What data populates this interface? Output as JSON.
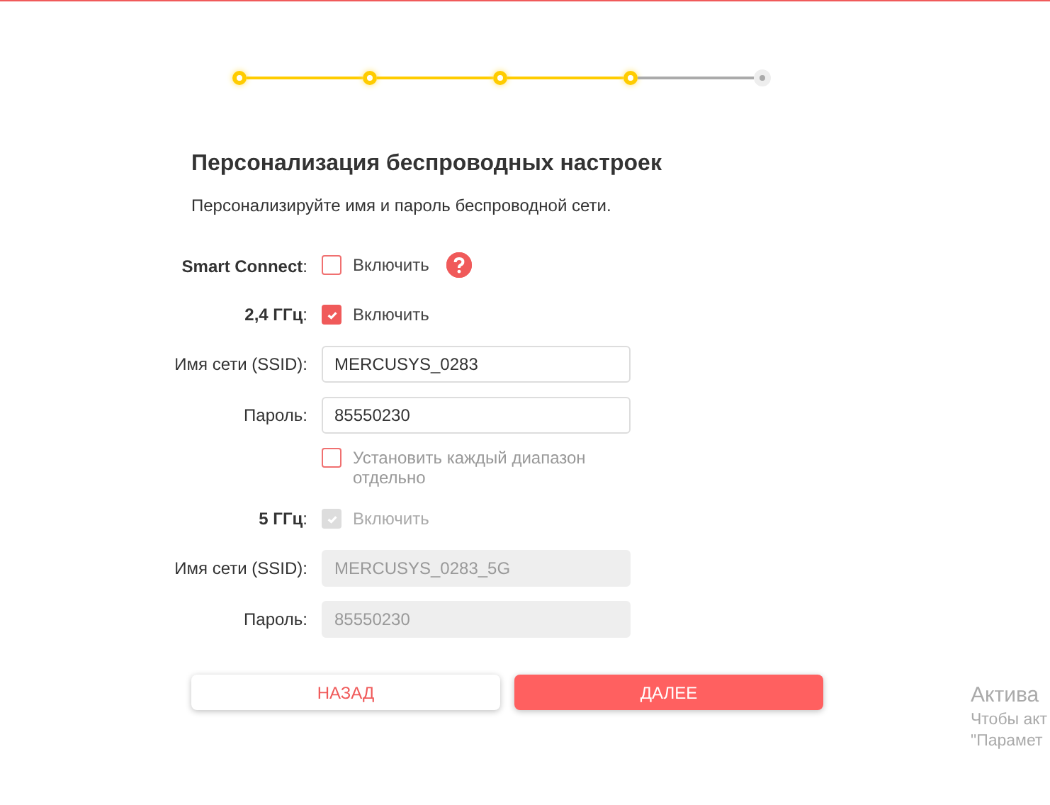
{
  "stepper": {
    "steps": [
      {
        "done": true
      },
      {
        "done": true
      },
      {
        "done": true
      },
      {
        "done": true
      },
      {
        "done": false
      }
    ]
  },
  "heading": {
    "title": "Персонализация беспроводных настроек",
    "subtitle": "Персонализируйте имя и пароль беспроводной сети."
  },
  "form": {
    "rows": [
      {
        "kind": "checkbox",
        "label": "**Smart Connect**:",
        "option": "Включить",
        "checked": false,
        "disabled": false,
        "help": true
      },
      {
        "kind": "checkbox",
        "label": "**2,4 ГГц**:",
        "option": "Включить",
        "checked": true,
        "disabled": false,
        "help": false
      },
      {
        "kind": "input",
        "label": "Имя сети (SSID):",
        "value": "MERCUSYS_0283",
        "disabled": false
      },
      {
        "kind": "input",
        "label": "Пароль:",
        "value": "85550230",
        "disabled": false
      },
      {
        "kind": "checkbox",
        "option": "Установить каждый диапазон отдельно",
        "checked": false,
        "disabled": false,
        "help": false
      },
      {
        "kind": "checkbox",
        "label": "**5 ГГц**:",
        "option": "Включить",
        "checked": true,
        "disabled": true,
        "help": false
      },
      {
        "kind": "input",
        "label": "Имя сети (SSID):",
        "value": "MERCUSYS_0283_5G",
        "disabled": true
      },
      {
        "kind": "input",
        "label": "Пароль:",
        "value": "85550230",
        "disabled": true
      }
    ]
  },
  "buttons": [
    {
      "label": "НАЗАД",
      "primary": false
    },
    {
      "label": "ДАЛЕЕ",
      "primary": true
    }
  ],
  "os_overlay": {
    "title": "Актива",
    "lines": [
      "Чтобы акт",
      "\"Парамет"
    ]
  }
}
